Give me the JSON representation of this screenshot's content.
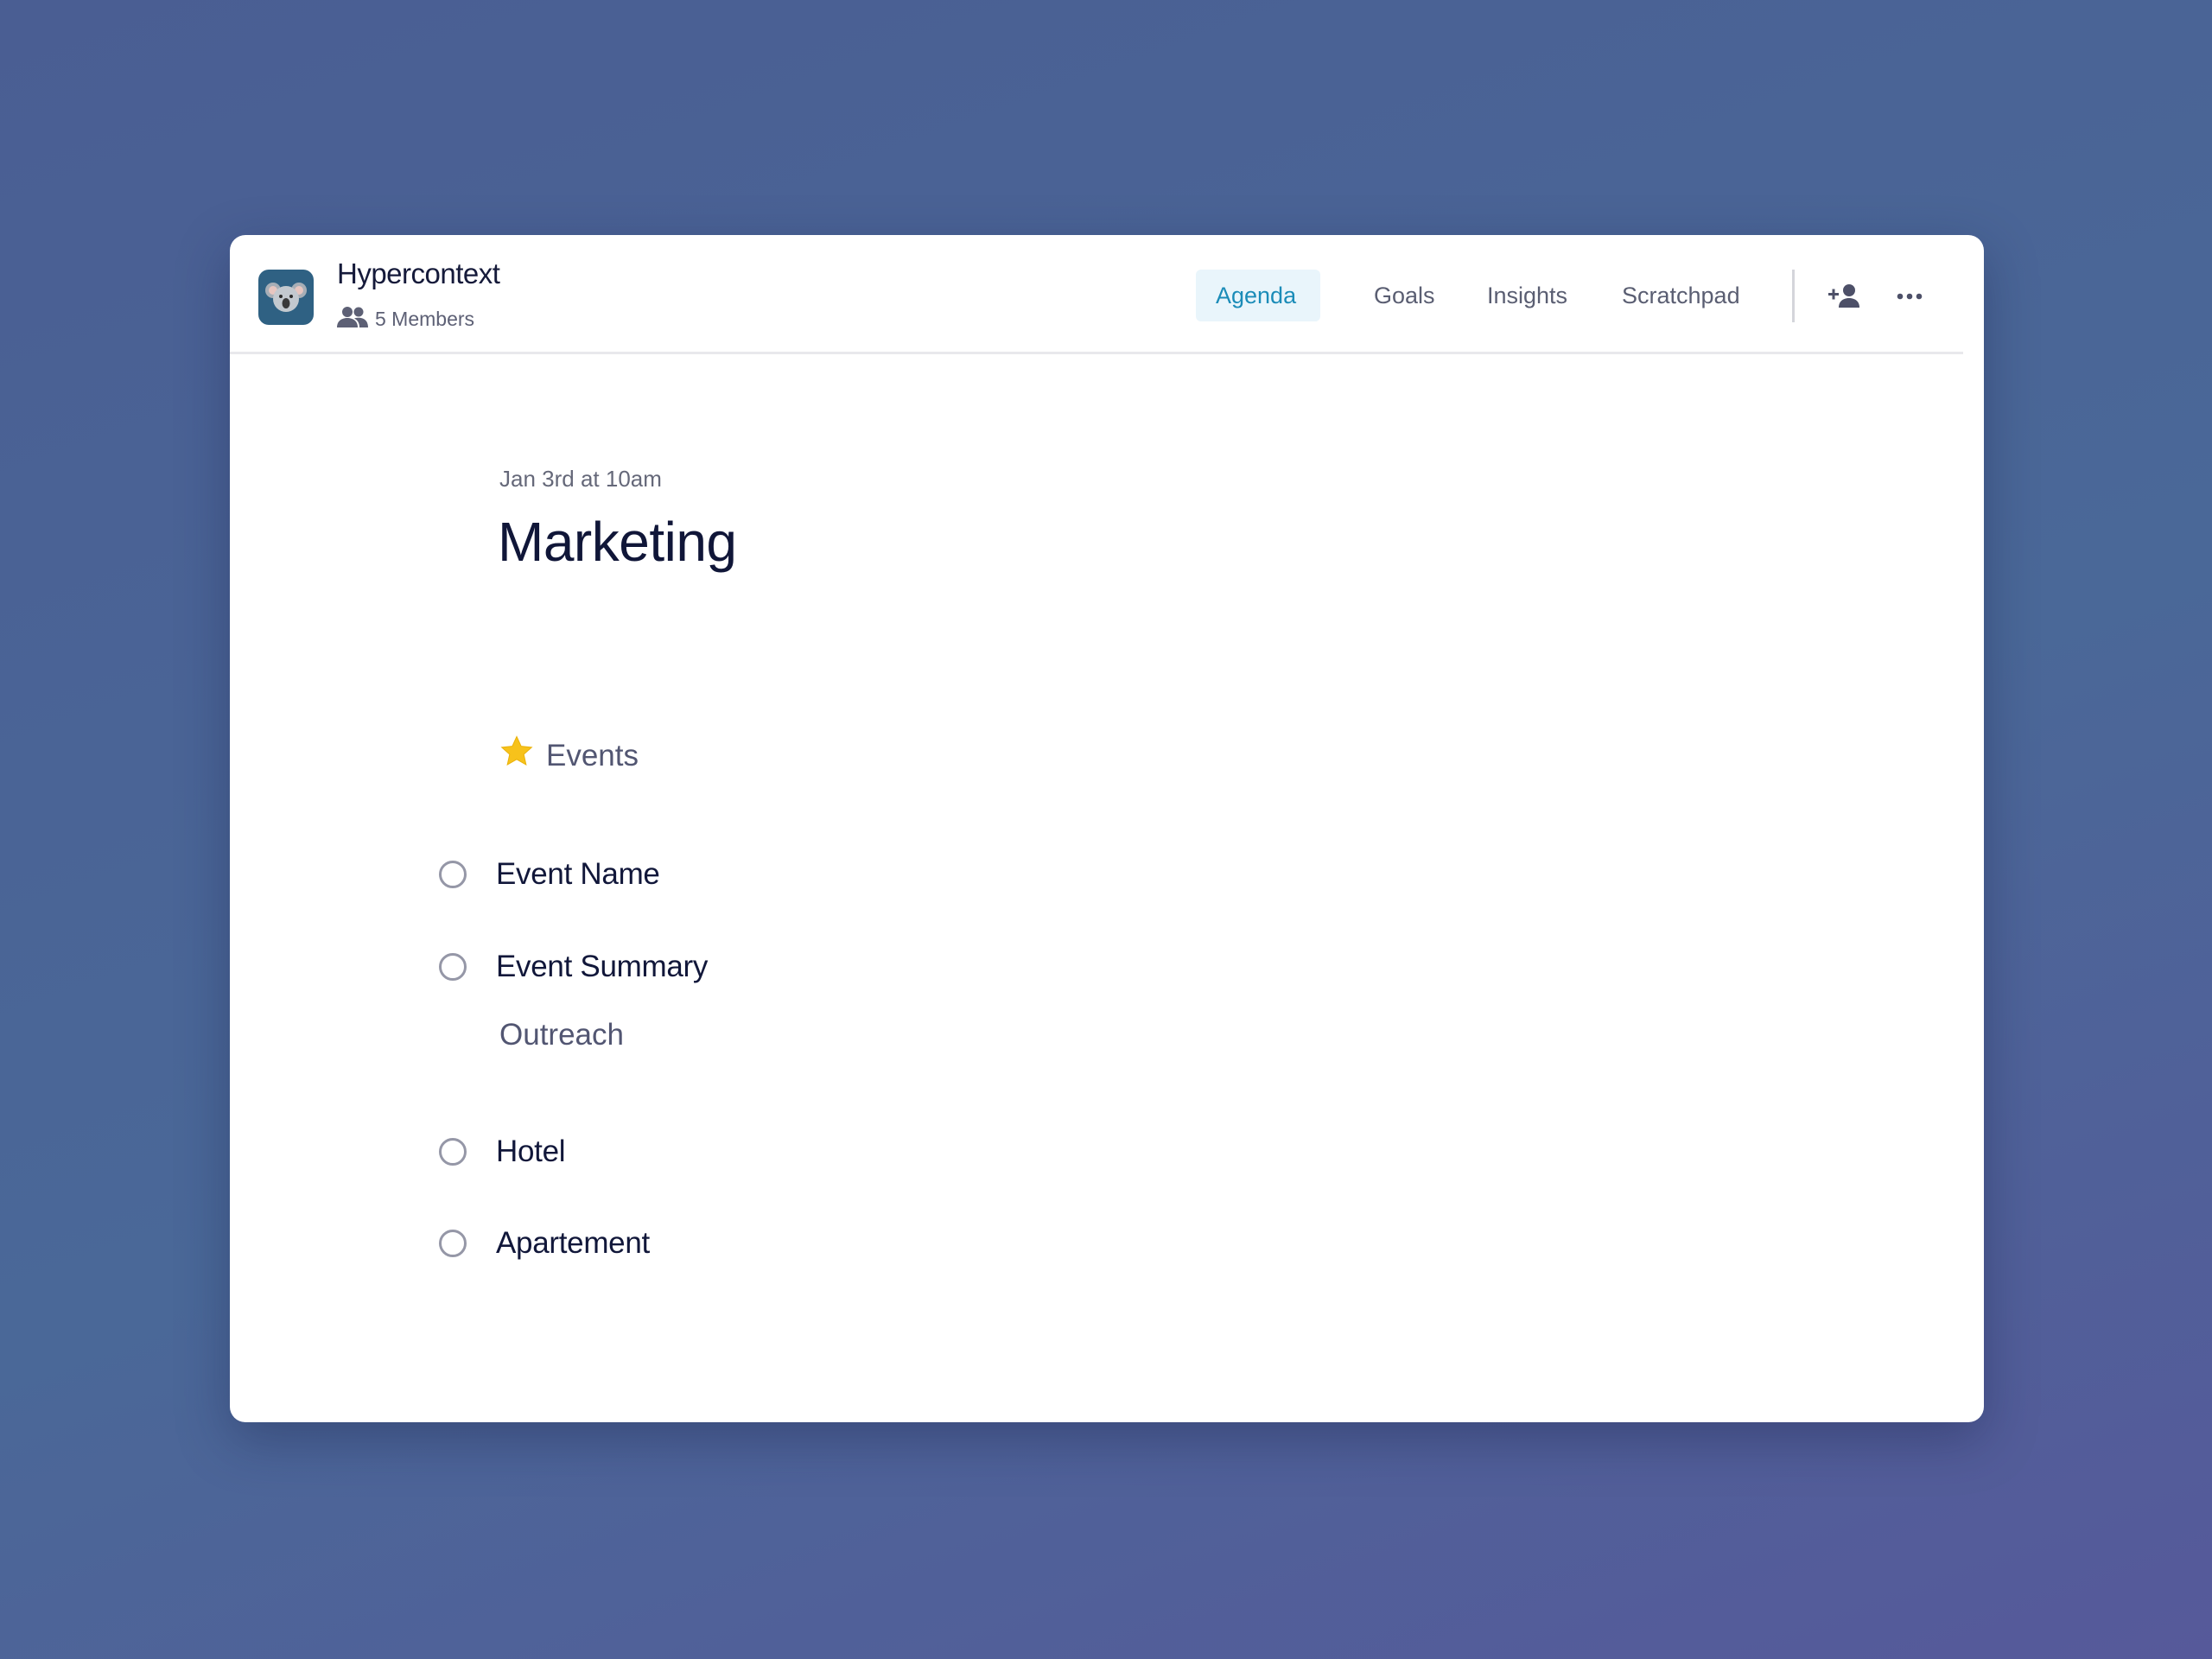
{
  "app": {
    "title": "Hypercontext",
    "members_label": "5 Members",
    "logo_icon": "koala-icon"
  },
  "tabs": [
    {
      "label": "Agenda",
      "active": true
    },
    {
      "label": "Goals",
      "active": false
    },
    {
      "label": "Insights",
      "active": false
    },
    {
      "label": "Scratchpad",
      "active": false
    }
  ],
  "header_actions": {
    "add_member_icon": "add-person-icon",
    "more_icon": "more-horizontal-icon"
  },
  "meeting": {
    "date": "Jan 3rd at 10am",
    "title": "Marketing"
  },
  "agenda": {
    "sections": [
      {
        "heading": "Events",
        "heading_icon": "star-icon",
        "items": [
          {
            "label": "Event Name",
            "checked": false
          },
          {
            "label": "Event Summary",
            "checked": false
          }
        ]
      },
      {
        "heading": "Outreach",
        "items": [
          {
            "label": "Hotel",
            "checked": false
          },
          {
            "label": "Apartement",
            "checked": false
          }
        ]
      }
    ]
  },
  "colors": {
    "accent": "#1b8cb8",
    "accent_bg": "#e9f5fb",
    "logo_bg": "#2f6183",
    "text_primary": "#11173a",
    "text_secondary": "#5a5e72"
  }
}
